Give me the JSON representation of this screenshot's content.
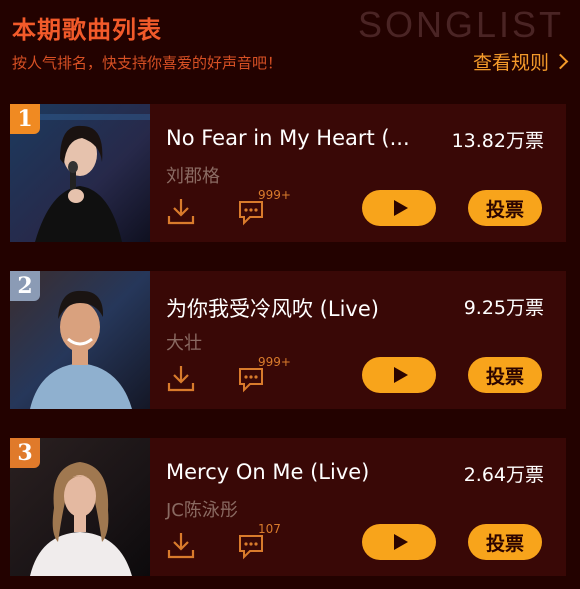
{
  "header": {
    "title": "本期歌曲列表",
    "watermark": "SONGLIST",
    "subtitle": "按人气排名，快支持你喜爱的好声音吧！",
    "rules_link": "查看规则"
  },
  "colors": {
    "accent": "#f8a41b",
    "title": "#f25a2a",
    "background": "#230200",
    "card": "#390806"
  },
  "songs": [
    {
      "rank": "1",
      "title": "No Fear in My Heart (...",
      "artist": "刘郡格",
      "votes": "13.82万票",
      "comments": "999+",
      "play_icon": "play-icon",
      "vote_label": "投票",
      "rank_color": "#f08a22"
    },
    {
      "rank": "2",
      "title": "为你我受冷风吹 (Live)",
      "artist": "大壮",
      "votes": "9.25万票",
      "comments": "999+",
      "play_icon": "play-icon",
      "vote_label": "投票",
      "rank_color": "#8b9bb5"
    },
    {
      "rank": "3",
      "title": "Mercy On Me (Live)",
      "artist": "JC陈泳彤",
      "votes": "2.64万票",
      "comments": "107",
      "play_icon": "play-icon",
      "vote_label": "投票",
      "rank_color": "#e07a2a"
    }
  ]
}
